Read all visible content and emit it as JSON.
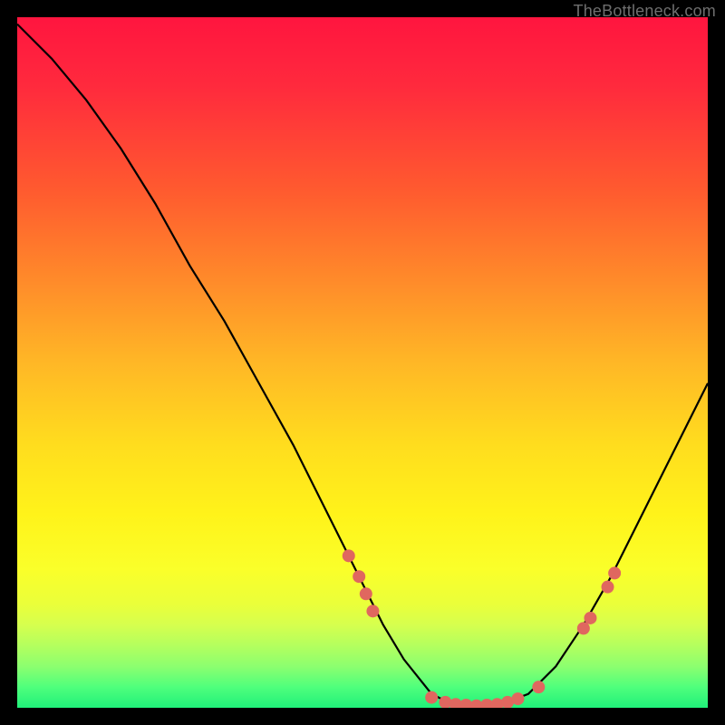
{
  "watermark": "TheBottleneck.com",
  "chart_data": {
    "type": "line",
    "title": "",
    "xlabel": "",
    "ylabel": "",
    "xlim": [
      0,
      100
    ],
    "ylim": [
      0,
      100
    ],
    "grid": false,
    "legend": false,
    "annotations": [],
    "series": [
      {
        "name": "curve",
        "x": [
          0,
          5,
          10,
          15,
          20,
          25,
          30,
          35,
          40,
          45,
          48,
          50,
          53,
          56,
          60,
          63,
          66,
          70,
          74,
          78,
          82,
          86,
          90,
          94,
          98,
          100
        ],
        "y": [
          99,
          94,
          88,
          81,
          73,
          64,
          56,
          47,
          38,
          28,
          22,
          18,
          12,
          7,
          2,
          0.5,
          0.3,
          0.5,
          2,
          6,
          12,
          19,
          27,
          35,
          43,
          47
        ]
      }
    ],
    "markers": [
      {
        "x": 48.0,
        "y": 22.0
      },
      {
        "x": 49.5,
        "y": 19.0
      },
      {
        "x": 50.5,
        "y": 16.5
      },
      {
        "x": 51.5,
        "y": 14.0
      },
      {
        "x": 60.0,
        "y": 1.5
      },
      {
        "x": 62.0,
        "y": 0.8
      },
      {
        "x": 63.5,
        "y": 0.5
      },
      {
        "x": 65.0,
        "y": 0.4
      },
      {
        "x": 66.5,
        "y": 0.3
      },
      {
        "x": 68.0,
        "y": 0.4
      },
      {
        "x": 69.5,
        "y": 0.5
      },
      {
        "x": 71.0,
        "y": 0.8
      },
      {
        "x": 72.5,
        "y": 1.3
      },
      {
        "x": 75.5,
        "y": 3.0
      },
      {
        "x": 82.0,
        "y": 11.5
      },
      {
        "x": 83.0,
        "y": 13.0
      },
      {
        "x": 85.5,
        "y": 17.5
      },
      {
        "x": 86.5,
        "y": 19.5
      }
    ],
    "marker_style": {
      "color": "#e0675f",
      "radius_px": 7
    }
  }
}
